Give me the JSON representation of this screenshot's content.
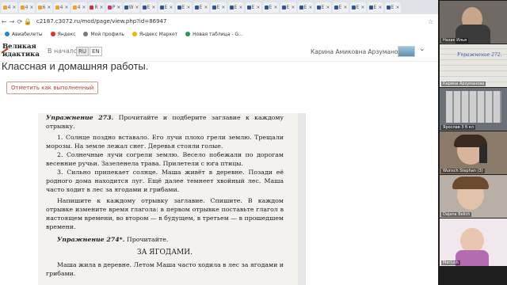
{
  "browser": {
    "tabs": [
      {
        "label": "4 ×",
        "color": "#f0a020"
      },
      {
        "label": "4 ×",
        "color": "#f0a020"
      },
      {
        "label": "6 ×",
        "color": "#f0a020"
      },
      {
        "label": "4 ×",
        "color": "#f0a020"
      },
      {
        "label": "4 ×",
        "color": "#f0a020"
      },
      {
        "label": "R ×",
        "color": "#d03030"
      },
      {
        "label": "P ×",
        "color": "#d03080"
      },
      {
        "label": "W ×",
        "color": "#2b5797"
      },
      {
        "label": "E ×",
        "color": "#2b5797"
      },
      {
        "label": "E ×",
        "color": "#2b5797"
      },
      {
        "label": "E ×",
        "color": "#2b5797"
      },
      {
        "label": "E ×",
        "color": "#2b5797"
      },
      {
        "label": "E ×",
        "color": "#2b5797"
      },
      {
        "label": "E ×",
        "color": "#2b5797"
      },
      {
        "label": "E ×",
        "color": "#2b5797"
      },
      {
        "label": "E ×",
        "color": "#2b5797"
      },
      {
        "label": "E ×",
        "color": "#2b5797"
      },
      {
        "label": "E ×",
        "color": "#2b5797"
      },
      {
        "label": "E ×",
        "color": "#2b5797"
      },
      {
        "label": "E ×",
        "color": "#2b5797"
      },
      {
        "label": "E ×",
        "color": "#2b5797"
      },
      {
        "label": "E ×",
        "color": "#2b5797"
      },
      {
        "label": "E ×",
        "color": "#2b5797"
      }
    ],
    "url": "c2187.c3072.ru/mod/page/view.php?id=86947",
    "bookmarks": [
      {
        "label": "Авиабилеты",
        "color": "#2a7de1"
      },
      {
        "label": "Яндекс",
        "color": "#e03030"
      },
      {
        "label": "Мой профиль",
        "color": "#7a7a7a"
      },
      {
        "label": "Яндекс Маркет",
        "color": "#f5b400"
      },
      {
        "label": "Новая таблица - G...",
        "color": "#1e9e4a"
      }
    ]
  },
  "site": {
    "logo_line1": "Великая",
    "logo_line2": "идактика",
    "nav_home": "В начало",
    "lang_ru": "RU",
    "lang_en": "EN",
    "user_name": "Карина Амиковна Арзуманова",
    "page_title": "Классная и домашняя работы.",
    "mark_done": "Отметить как выполненный"
  },
  "document": {
    "ex273_title": "Упражнение 273.",
    "ex273_task": "Прочитайте и подберите заглавие к каждому отрывку.",
    "p1": "1. Солнце поздно вставало. Его лучи плохо грели землю. Трещали морозы. На земле лежал снег. Деревья стояли голые.",
    "p2": "2. Солнечные лучи согрели землю. Весело побежали по дорогам весенние ручьи. Зазеленела трава. Прилетели с юга птицы.",
    "p3": "3. Сильно припекает солнце. Маша живёт в деревне. Позади её родного дома находится луг. Ещё далее темнеет хвойный лес. Маша часто ходит в лес за ягодами и грибами.",
    "task_text": "Напишите к каждому отрывку заглавие. Спишите. В каждом отрывке измените время глагола: в первом отрывке поставьте глагол в настоящем времени, во втором — в будущем, в третьем — в прошедшем времени.",
    "ex274_title": "Упражнение 274*.",
    "ex274_task": "Прочитайте.",
    "story_title": "ЗА ЯГОДАМИ.",
    "story_p1": "Маша жила в деревне. Летом Маша часто ходила в лес за ягодами и грибами."
  },
  "video_call": {
    "participants": [
      {
        "name": "Назак Илья",
        "bg": "#6f6a63"
      },
      {
        "name": "Карина Арзуманова",
        "bg": "#e9e6de"
      },
      {
        "name": "Ярослав 3 б кл",
        "bg": "#6b7078"
      },
      {
        "name": "Wunsch Stephan (3)",
        "bg": "#8a7a6a"
      },
      {
        "name": "Dajana Belich",
        "bg": "#b8b0a6"
      },
      {
        "name": "Mariush",
        "bg": "#f0e8ec"
      }
    ],
    "notebook_text": "Упражнение 272."
  }
}
